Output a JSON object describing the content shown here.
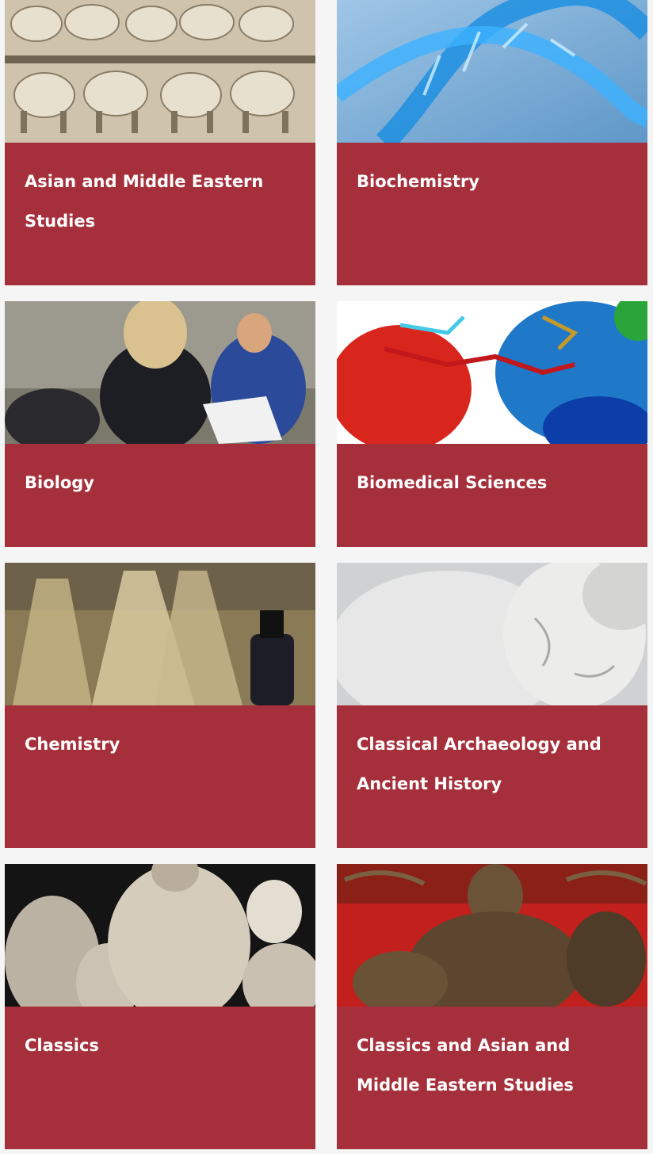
{
  "cards": [
    {
      "title": "Asian and Middle Eastern Studies",
      "image": "ivory-elephant-relief-image"
    },
    {
      "title": "Biochemistry",
      "image": "dna-helix-image"
    },
    {
      "title": "Biology",
      "image": "students-fieldwork-image"
    },
    {
      "title": "Biomedical Sciences",
      "image": "protein-structure-image"
    },
    {
      "title": "Chemistry",
      "image": "glass-flasks-image"
    },
    {
      "title": "Classical Archaeology and Ancient History",
      "image": "marble-head-statue-image"
    },
    {
      "title": "Classics",
      "image": "classical-statues-image"
    },
    {
      "title": "Classics and Asian and Middle Eastern Studies",
      "image": "bronze-deity-statue-image"
    }
  ],
  "colors": {
    "card_bg": "#a5303b",
    "page_bg": "#f5f5f5",
    "title_text": "#ffffff"
  }
}
